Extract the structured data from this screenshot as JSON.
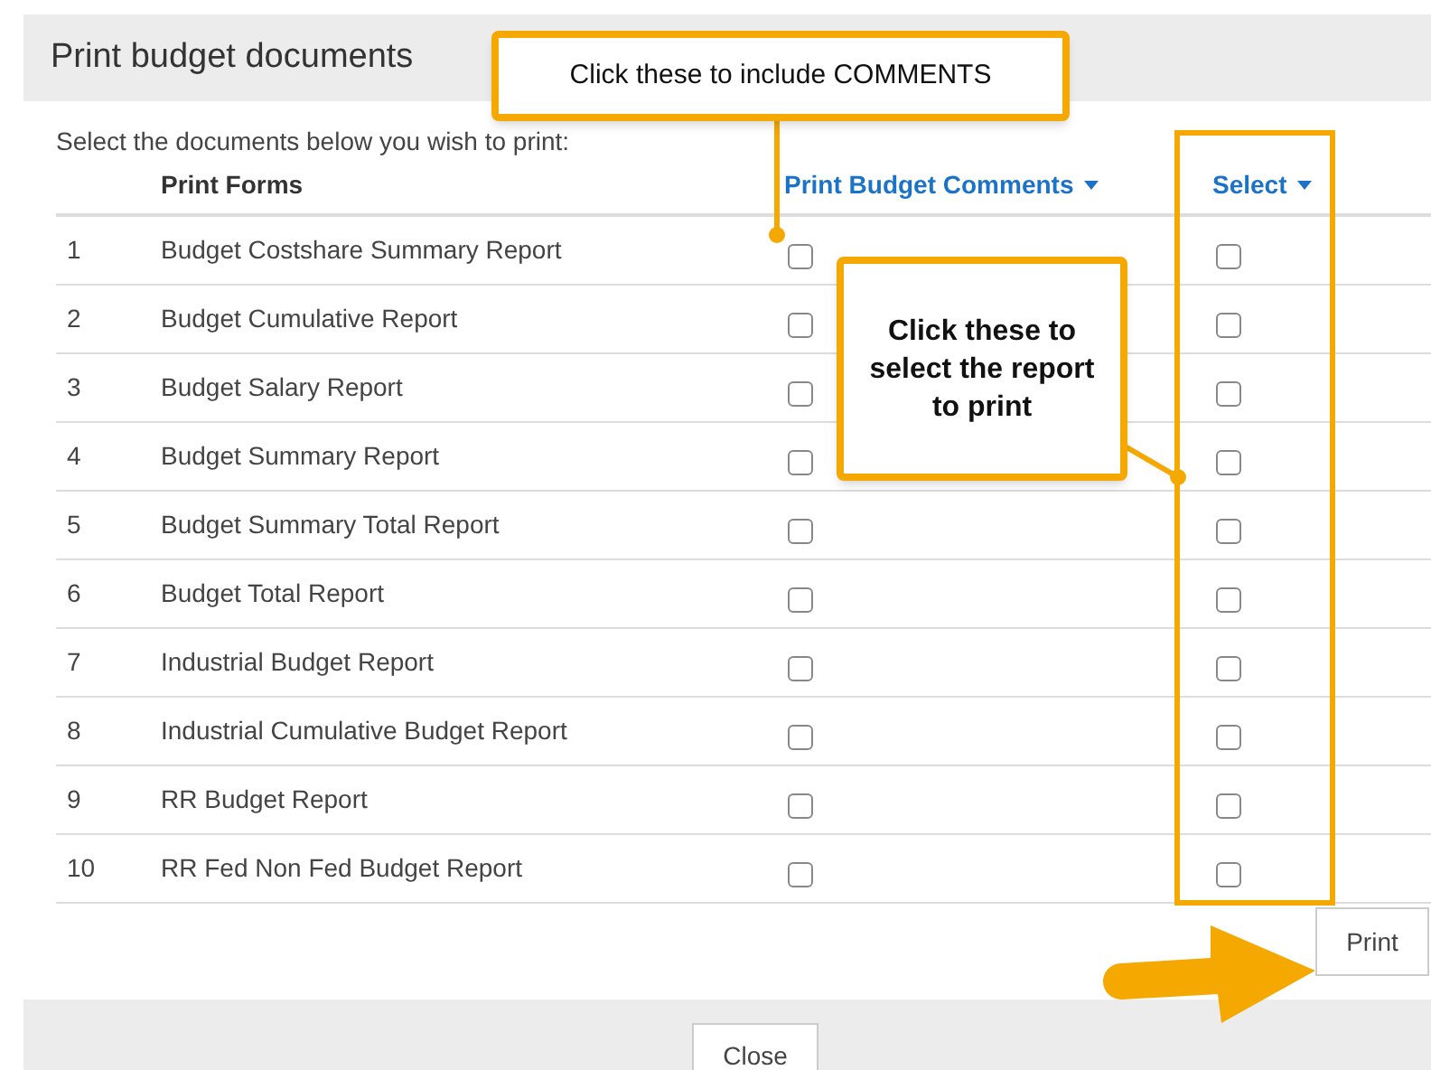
{
  "dialog": {
    "title": "Print budget documents",
    "instructions": "Select the documents below you wish to print:"
  },
  "table": {
    "columns": [
      "Print Forms",
      "Print Budget Comments",
      "Select"
    ],
    "rows": [
      {
        "number": "1",
        "name": "Budget Costshare Summary Report",
        "comments": false,
        "selected": false
      },
      {
        "number": "2",
        "name": "Budget Cumulative Report",
        "comments": false,
        "selected": false
      },
      {
        "number": "3",
        "name": "Budget Salary Report",
        "comments": false,
        "selected": false
      },
      {
        "number": "4",
        "name": "Budget Summary Report",
        "comments": false,
        "selected": false
      },
      {
        "number": "5",
        "name": "Budget Summary Total Report",
        "comments": false,
        "selected": false
      },
      {
        "number": "6",
        "name": "Budget Total Report",
        "comments": false,
        "selected": false
      },
      {
        "number": "7",
        "name": "Industrial Budget Report",
        "comments": false,
        "selected": false
      },
      {
        "number": "8",
        "name": "Industrial Cumulative Budget Report",
        "comments": false,
        "selected": false
      },
      {
        "number": "9",
        "name": "RR Budget Report",
        "comments": false,
        "selected": false
      },
      {
        "number": "10",
        "name": "RR Fed Non Fed Budget Report",
        "comments": false,
        "selected": false
      }
    ]
  },
  "print_button": "Print",
  "close_button": "Close",
  "annotations": [
    {
      "text": "Click these to include COMMENTS"
    },
    {
      "text": "Click these to select the report to print"
    }
  ]
}
